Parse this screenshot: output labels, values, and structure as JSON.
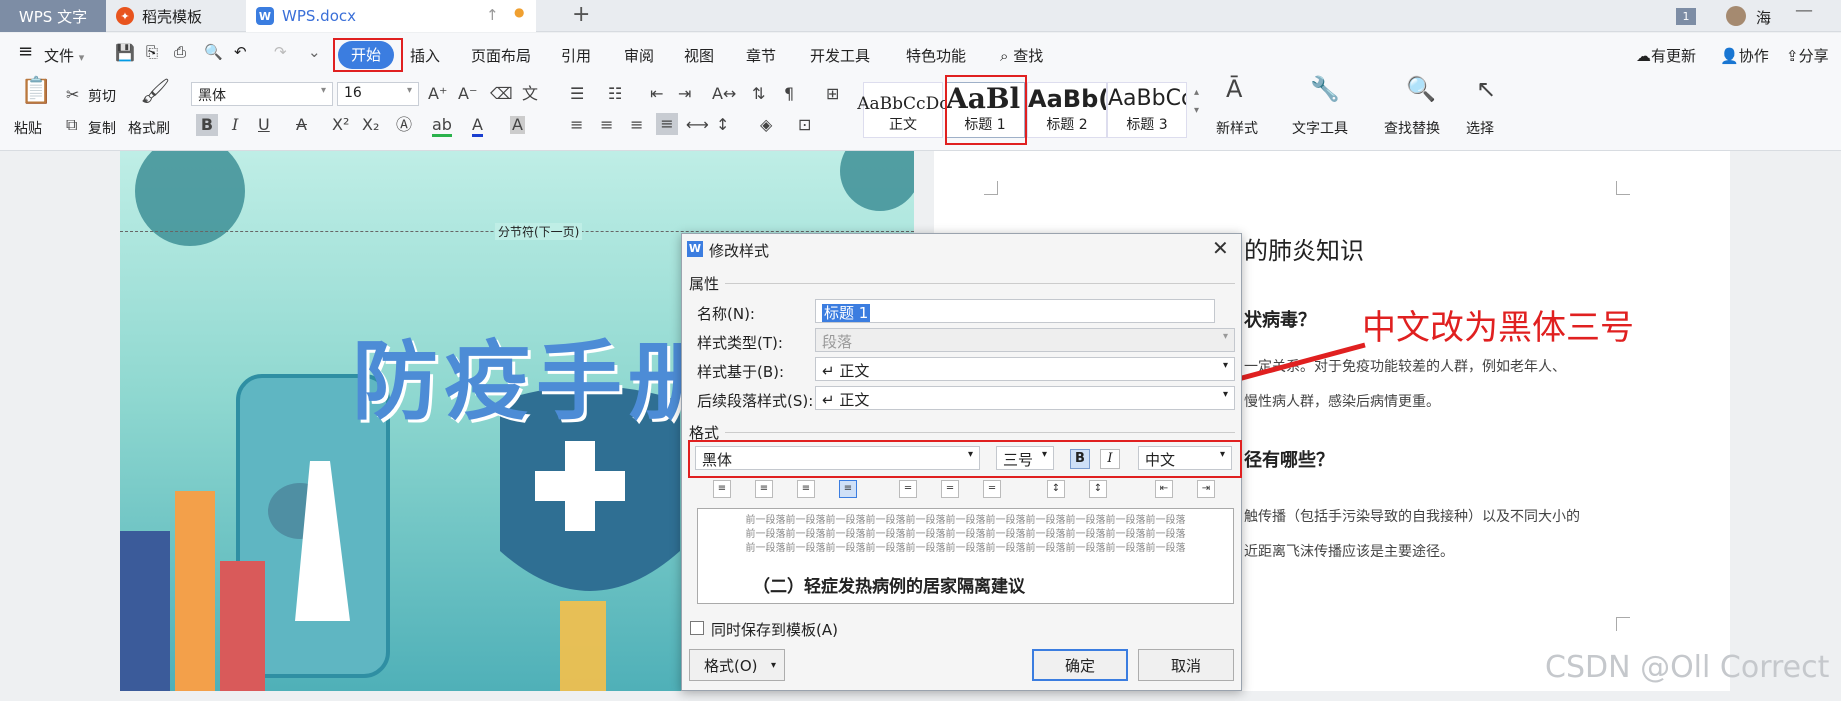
{
  "tabs": {
    "app": "WPS 文字",
    "template": "稻壳模板",
    "document": "WPS.docx",
    "new_tab": "+"
  },
  "titlebar": {
    "badge": "1",
    "user": "海"
  },
  "menu": {
    "file": "文件",
    "items": [
      "开始",
      "插入",
      "页面布局",
      "引用",
      "审阅",
      "视图",
      "章节",
      "开发工具",
      "特色功能"
    ],
    "search": "查找",
    "right": {
      "update": "有更新",
      "collab": "协作",
      "share": "分享"
    }
  },
  "ribbon": {
    "paste": "粘贴",
    "cut": "剪切",
    "copy": "复制",
    "format_painter": "格式刷",
    "font": "黑体",
    "size": "16",
    "styles": [
      {
        "preview": "AaBbCcDc",
        "label": "正文"
      },
      {
        "preview": "AaBl",
        "label": "标题 1"
      },
      {
        "preview": "AaBb(",
        "label": "标题 2"
      },
      {
        "preview": "AaBbCc",
        "label": "标题 3"
      }
    ],
    "new_style": "新样式",
    "text_tools": "文字工具",
    "find_replace": "查找替换",
    "select": "选择"
  },
  "cover": {
    "section_break": "分节符(下一页)",
    "title": "防疫手册"
  },
  "document": {
    "heading": "的肺炎知识",
    "q1": "状病毒？",
    "p1a": "一定关系。对于免疫功能较差的人群，例如老年人、",
    "p1b": "慢性病人群，感染后病情更重。",
    "q2": "径有哪些？",
    "p2a": "触传播（包括手污染导致的自我接种）以及不同大小的",
    "p2b": "近距离飞沫传播应该是主要途径。"
  },
  "annotation": "中文改为黑体三号",
  "dialog": {
    "title": "修改样式",
    "props_label": "属性",
    "name_label": "名称(N):",
    "name_value": "标题 1",
    "type_label": "样式类型(T):",
    "type_value": "段落",
    "based_label": "样式基于(B):",
    "based_value": "正文",
    "next_label": "后续段落样式(S):",
    "next_value": "正文",
    "format_label": "格式",
    "font": "黑体",
    "size": "三号",
    "bold": "B",
    "italic": "I",
    "script": "中文",
    "preview_prev": "前一段落前一段落前一段落前一段落前一段落前一段落前一段落前一段落前一段落前一段落前一段落",
    "preview_sample": "（二）轻症发热病例的居家隔离建议",
    "save_template": "同时保存到模板(A)",
    "format_btn": "格式(O)",
    "ok": "确定",
    "cancel": "取消"
  },
  "watermark": "CSDN @Oll Correct",
  "colors": {
    "accent": "#3b7de0",
    "annotation": "#e02020"
  }
}
